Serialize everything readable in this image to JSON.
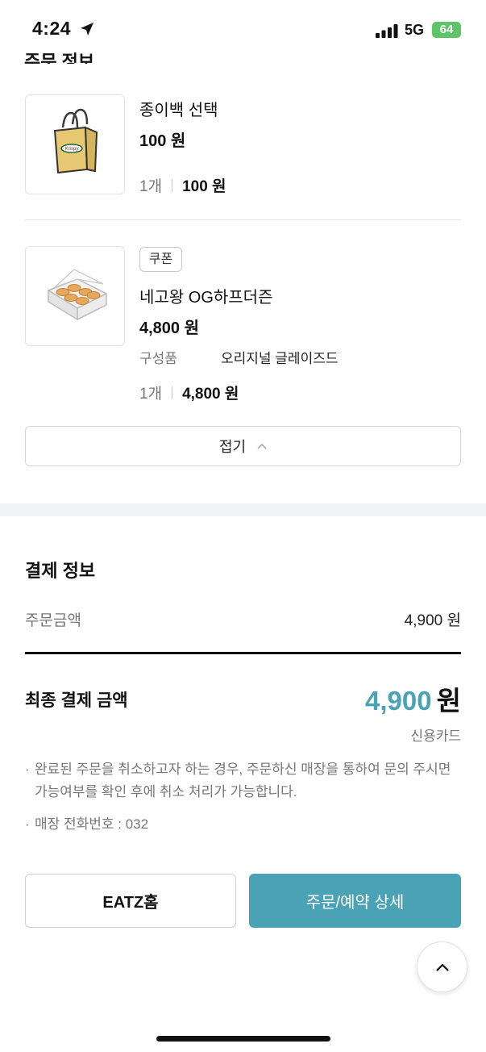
{
  "status_bar": {
    "time": "4:24",
    "network": "5G",
    "battery": "64"
  },
  "section": {
    "heading_cutoff": "주문 정보"
  },
  "items": [
    {
      "name": "종이백 선택",
      "price": "100 원",
      "qty": "1개",
      "total": "100 원",
      "image_icon": "paper-bag-icon"
    },
    {
      "badge": "쿠폰",
      "name": "네고왕 OG하프더즌",
      "price": "4,800 원",
      "component_label": "구성품",
      "component_value": "오리지널 글레이즈드",
      "qty": "1개",
      "total": "4,800 원",
      "image_icon": "donut-box-icon"
    }
  ],
  "fold_button": {
    "label": "접기"
  },
  "payment": {
    "title": "결제 정보",
    "order_amount_label": "주문금액",
    "order_amount_value": "4,900 원",
    "final_label": "최종 결제 금액",
    "final_amount": "4,900",
    "final_currency": "원",
    "method": "신용카드"
  },
  "notices": [
    "완료된 주문을 취소하고자 하는 경우, 주문하신 매장을 통하여 문의 주시면 가능여부를 확인 후에 취소 처리가 가능합니다.",
    "매장 전화번호 : 032"
  ],
  "buttons": {
    "home": "EATZ홈",
    "detail": "주문/예약 상세"
  },
  "colors": {
    "accent": "#4aa3b4",
    "battery": "#5fc36a"
  }
}
